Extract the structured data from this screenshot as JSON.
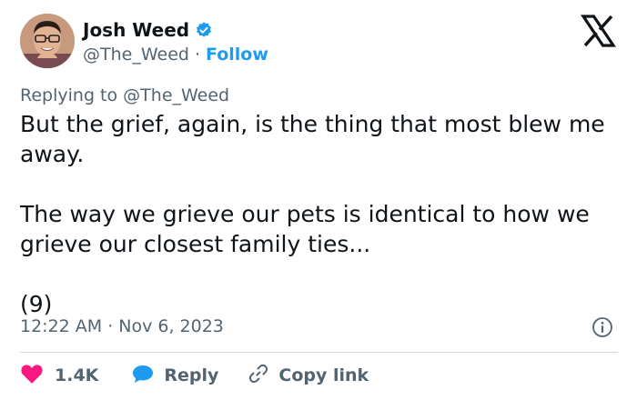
{
  "author": {
    "name": "Josh Weed",
    "handle": "@The_Weed",
    "separator": "·",
    "follow_label": "Follow",
    "verified_color": "#1d9bf0",
    "avatar": "profile-photo"
  },
  "platform": {
    "logo": "x-logo"
  },
  "reply_context": {
    "prefix": "Replying to",
    "mention": "@The_Weed"
  },
  "tweet": {
    "paragraphs": [
      "But the grief, again, is the thing that most blew me away.",
      "The way we grieve our pets is identical to how we grieve our closest family ties...",
      "(9)"
    ]
  },
  "meta": {
    "time": "12:22 AM",
    "separator": "·",
    "date": "Nov 6, 2023",
    "info_icon": "info-icon"
  },
  "actions": {
    "like": {
      "icon": "heart-icon",
      "count": "1.4K",
      "color": "#f91880"
    },
    "reply": {
      "icon": "speech-bubble-icon",
      "label": "Reply",
      "color": "#1d9bf0"
    },
    "copy": {
      "icon": "link-icon",
      "label": "Copy link"
    }
  },
  "colors": {
    "text_primary": "#0f1419",
    "text_secondary": "#536471",
    "accent": "#1d9bf0",
    "divider": "#cfd9de"
  }
}
